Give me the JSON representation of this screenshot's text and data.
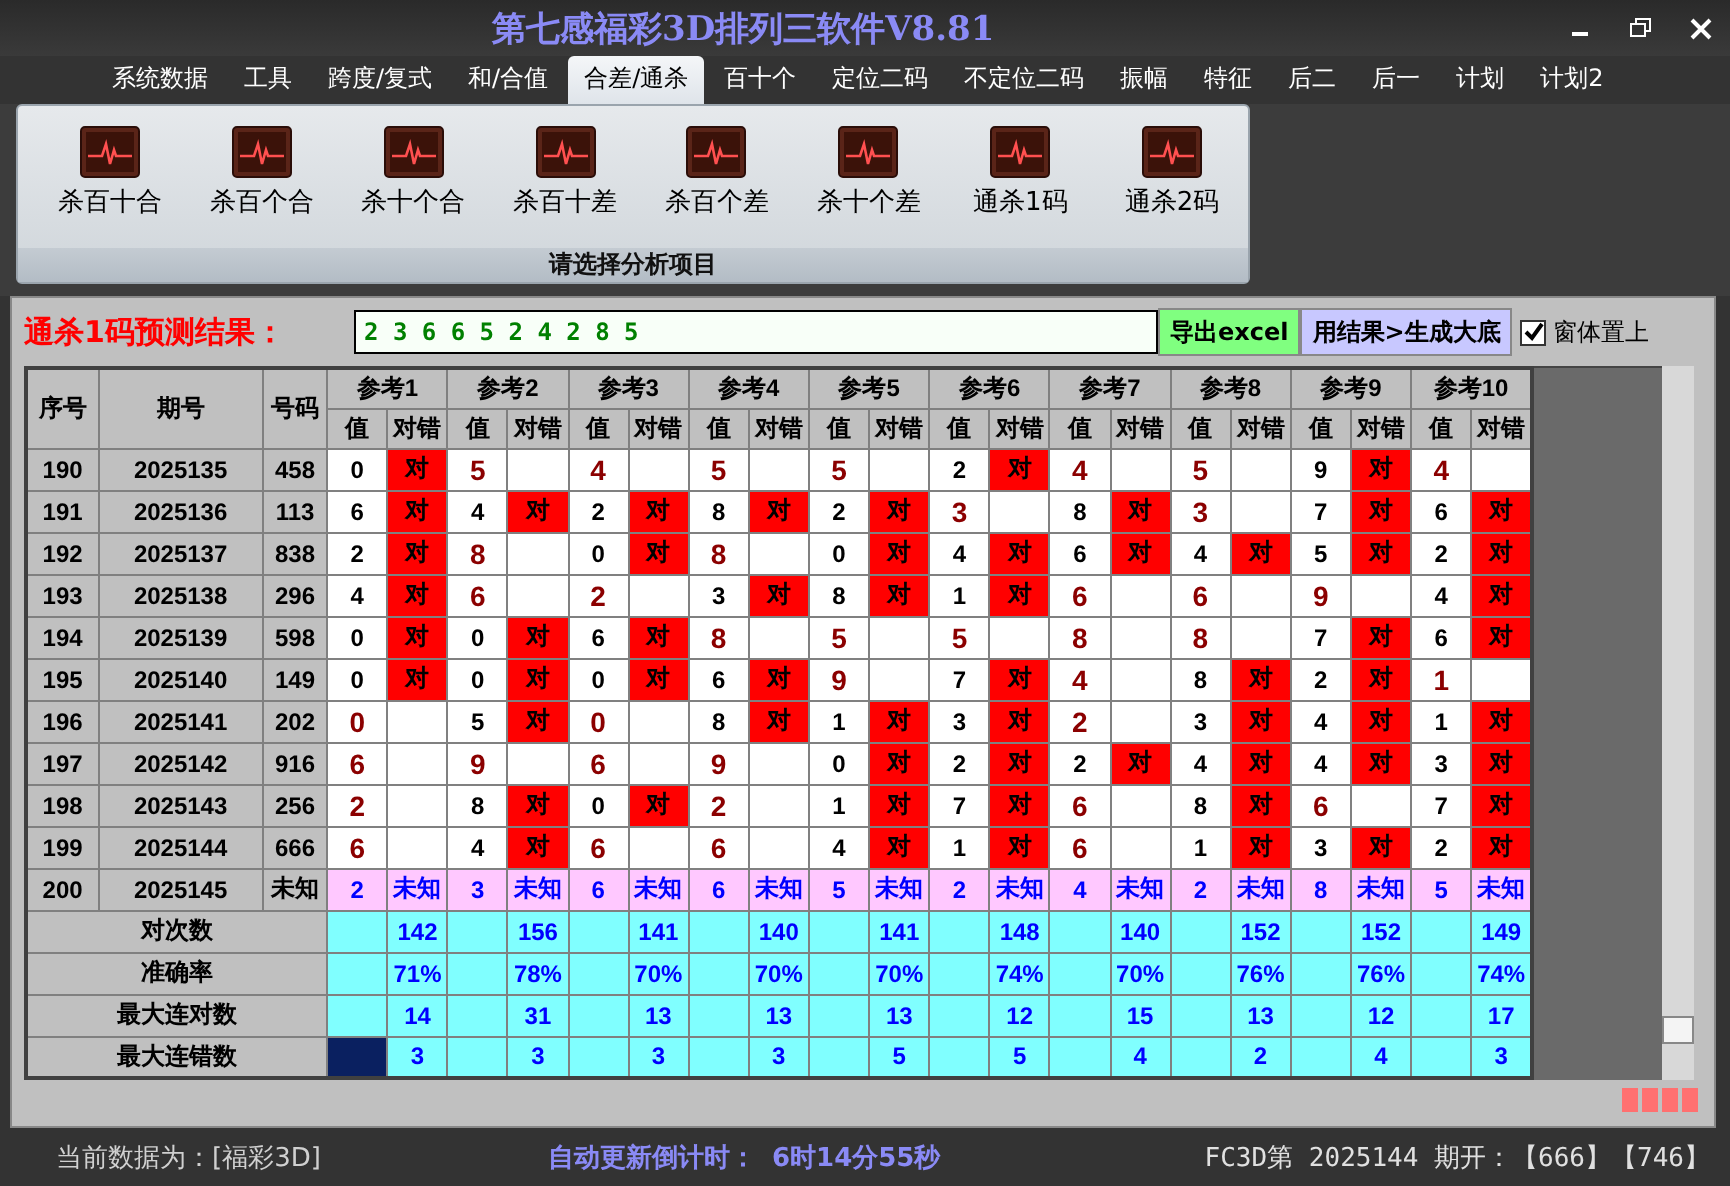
{
  "window": {
    "title": "第七感福彩3D排列三软件V8.81"
  },
  "menu": [
    {
      "label": "系统数据",
      "selected": false
    },
    {
      "label": "工具",
      "selected": false
    },
    {
      "label": "跨度/复式",
      "selected": false
    },
    {
      "label": "和/合值",
      "selected": false
    },
    {
      "label": "合差/通杀",
      "selected": true
    },
    {
      "label": "百十个",
      "selected": false
    },
    {
      "label": "定位二码",
      "selected": false
    },
    {
      "label": "不定位二码",
      "selected": false
    },
    {
      "label": "振幅",
      "selected": false
    },
    {
      "label": "特征",
      "selected": false
    },
    {
      "label": "后二",
      "selected": false
    },
    {
      "label": "后一",
      "selected": false
    },
    {
      "label": "计划",
      "selected": false
    },
    {
      "label": "计划2",
      "selected": false
    }
  ],
  "ribbon": {
    "items": [
      "杀百十合",
      "杀百个合",
      "杀十个合",
      "杀百十差",
      "杀百个差",
      "杀十个差",
      "通杀1码",
      "通杀2码"
    ],
    "group_label": "请选择分析项目"
  },
  "prediction": {
    "label": "通杀1码预测结果：",
    "value": "2 3 6 6 5 2 4 2 8 5",
    "export_button": "导出excel",
    "generate_button": "用结果>生成大底",
    "topmost": {
      "label": "窗体置上",
      "checked": true
    }
  },
  "table": {
    "columns": {
      "index": "序号",
      "period": "期号",
      "number": "号码"
    },
    "refs": [
      {
        "name": "参考1",
        "value_header": "值",
        "hit_header": "对错"
      },
      {
        "name": "参考2",
        "value_header": "值",
        "hit_header": "对错"
      },
      {
        "name": "参考3",
        "value_header": "值",
        "hit_header": "对错"
      },
      {
        "name": "参考4",
        "value_header": "值",
        "hit_header": "对错"
      },
      {
        "name": "参考5",
        "value_header": "值",
        "hit_header": "对错"
      },
      {
        "name": "参考6",
        "value_header": "值",
        "hit_header": "对错"
      },
      {
        "name": "参考7",
        "value_header": "值",
        "hit_header": "对错"
      },
      {
        "name": "参考8",
        "value_header": "值",
        "hit_header": "对错"
      },
      {
        "name": "参考9",
        "value_header": "值",
        "hit_header": "对错"
      },
      {
        "name": "参考10",
        "value_header": "值",
        "hit_header": "对错"
      }
    ],
    "rows": [
      {
        "index": "190",
        "period": "2025135",
        "number": "458",
        "cells": [
          {
            "value": "0",
            "hit": true,
            "result": "对"
          },
          {
            "value": "5",
            "hit": false
          },
          {
            "value": "4",
            "hit": false
          },
          {
            "value": "5",
            "hit": false
          },
          {
            "value": "5",
            "hit": false
          },
          {
            "value": "2",
            "hit": true,
            "result": "对"
          },
          {
            "value": "4",
            "hit": false
          },
          {
            "value": "5",
            "hit": false
          },
          {
            "value": "9",
            "hit": true,
            "result": "对"
          },
          {
            "value": "4",
            "hit": false
          }
        ]
      },
      {
        "index": "191",
        "period": "2025136",
        "number": "113",
        "cells": [
          {
            "value": "6",
            "hit": true,
            "result": "对"
          },
          {
            "value": "4",
            "hit": true,
            "result": "对"
          },
          {
            "value": "2",
            "hit": true,
            "result": "对"
          },
          {
            "value": "8",
            "hit": true,
            "result": "对"
          },
          {
            "value": "2",
            "hit": true,
            "result": "对"
          },
          {
            "value": "3",
            "hit": false
          },
          {
            "value": "8",
            "hit": true,
            "result": "对"
          },
          {
            "value": "3",
            "hit": false
          },
          {
            "value": "7",
            "hit": true,
            "result": "对"
          },
          {
            "value": "6",
            "hit": true,
            "result": "对"
          }
        ]
      },
      {
        "index": "192",
        "period": "2025137",
        "number": "838",
        "cells": [
          {
            "value": "2",
            "hit": true,
            "result": "对"
          },
          {
            "value": "8",
            "hit": false
          },
          {
            "value": "0",
            "hit": true,
            "result": "对"
          },
          {
            "value": "8",
            "hit": false
          },
          {
            "value": "0",
            "hit": true,
            "result": "对"
          },
          {
            "value": "4",
            "hit": true,
            "result": "对"
          },
          {
            "value": "6",
            "hit": true,
            "result": "对"
          },
          {
            "value": "4",
            "hit": true,
            "result": "对"
          },
          {
            "value": "5",
            "hit": true,
            "result": "对"
          },
          {
            "value": "2",
            "hit": true,
            "result": "对"
          }
        ]
      },
      {
        "index": "193",
        "period": "2025138",
        "number": "296",
        "cells": [
          {
            "value": "4",
            "hit": true,
            "result": "对"
          },
          {
            "value": "6",
            "hit": false
          },
          {
            "value": "2",
            "hit": false
          },
          {
            "value": "3",
            "hit": true,
            "result": "对"
          },
          {
            "value": "8",
            "hit": true,
            "result": "对"
          },
          {
            "value": "1",
            "hit": true,
            "result": "对"
          },
          {
            "value": "6",
            "hit": false
          },
          {
            "value": "6",
            "hit": false
          },
          {
            "value": "9",
            "hit": false
          },
          {
            "value": "4",
            "hit": true,
            "result": "对"
          }
        ]
      },
      {
        "index": "194",
        "period": "2025139",
        "number": "598",
        "cells": [
          {
            "value": "0",
            "hit": true,
            "result": "对"
          },
          {
            "value": "0",
            "hit": true,
            "result": "对"
          },
          {
            "value": "6",
            "hit": true,
            "result": "对"
          },
          {
            "value": "8",
            "hit": false
          },
          {
            "value": "5",
            "hit": false
          },
          {
            "value": "5",
            "hit": false
          },
          {
            "value": "8",
            "hit": false
          },
          {
            "value": "8",
            "hit": false
          },
          {
            "value": "7",
            "hit": true,
            "result": "对"
          },
          {
            "value": "6",
            "hit": true,
            "result": "对"
          }
        ]
      },
      {
        "index": "195",
        "period": "2025140",
        "number": "149",
        "cells": [
          {
            "value": "0",
            "hit": true,
            "result": "对"
          },
          {
            "value": "0",
            "hit": true,
            "result": "对"
          },
          {
            "value": "0",
            "hit": true,
            "result": "对"
          },
          {
            "value": "6",
            "hit": true,
            "result": "对"
          },
          {
            "value": "9",
            "hit": false
          },
          {
            "value": "7",
            "hit": true,
            "result": "对"
          },
          {
            "value": "4",
            "hit": false
          },
          {
            "value": "8",
            "hit": true,
            "result": "对"
          },
          {
            "value": "2",
            "hit": true,
            "result": "对"
          },
          {
            "value": "1",
            "hit": false
          }
        ]
      },
      {
        "index": "196",
        "period": "2025141",
        "number": "202",
        "cells": [
          {
            "value": "0",
            "hit": false
          },
          {
            "value": "5",
            "hit": true,
            "result": "对"
          },
          {
            "value": "0",
            "hit": false
          },
          {
            "value": "8",
            "hit": true,
            "result": "对"
          },
          {
            "value": "1",
            "hit": true,
            "result": "对"
          },
          {
            "value": "3",
            "hit": true,
            "result": "对"
          },
          {
            "value": "2",
            "hit": false
          },
          {
            "value": "3",
            "hit": true,
            "result": "对"
          },
          {
            "value": "4",
            "hit": true,
            "result": "对"
          },
          {
            "value": "1",
            "hit": true,
            "result": "对"
          }
        ]
      },
      {
        "index": "197",
        "period": "2025142",
        "number": "916",
        "cells": [
          {
            "value": "6",
            "hit": false
          },
          {
            "value": "9",
            "hit": false
          },
          {
            "value": "6",
            "hit": false
          },
          {
            "value": "9",
            "hit": false
          },
          {
            "value": "0",
            "hit": true,
            "result": "对"
          },
          {
            "value": "2",
            "hit": true,
            "result": "对"
          },
          {
            "value": "2",
            "hit": true,
            "result": "对"
          },
          {
            "value": "4",
            "hit": true,
            "result": "对"
          },
          {
            "value": "4",
            "hit": true,
            "result": "对"
          },
          {
            "value": "3",
            "hit": true,
            "result": "对"
          }
        ]
      },
      {
        "index": "198",
        "period": "2025143",
        "number": "256",
        "cells": [
          {
            "value": "2",
            "hit": false
          },
          {
            "value": "8",
            "hit": true,
            "result": "对"
          },
          {
            "value": "0",
            "hit": true,
            "result": "对"
          },
          {
            "value": "2",
            "hit": false
          },
          {
            "value": "1",
            "hit": true,
            "result": "对"
          },
          {
            "value": "7",
            "hit": true,
            "result": "对"
          },
          {
            "value": "6",
            "hit": false
          },
          {
            "value": "8",
            "hit": true,
            "result": "对"
          },
          {
            "value": "6",
            "hit": false
          },
          {
            "value": "7",
            "hit": true,
            "result": "对"
          }
        ]
      },
      {
        "index": "199",
        "period": "2025144",
        "number": "666",
        "cells": [
          {
            "value": "6",
            "hit": false
          },
          {
            "value": "4",
            "hit": true,
            "result": "对"
          },
          {
            "value": "6",
            "hit": false
          },
          {
            "value": "6",
            "hit": false
          },
          {
            "value": "4",
            "hit": true,
            "result": "对"
          },
          {
            "value": "1",
            "hit": true,
            "result": "对"
          },
          {
            "value": "6",
            "hit": false
          },
          {
            "value": "1",
            "hit": true,
            "result": "对"
          },
          {
            "value": "3",
            "hit": true,
            "result": "对"
          },
          {
            "value": "2",
            "hit": true,
            "result": "对"
          }
        ]
      }
    ],
    "forecast_row": {
      "index": "200",
      "period": "2025145",
      "number": "未知",
      "cells": [
        {
          "value": "2",
          "status": "未知"
        },
        {
          "value": "3",
          "status": "未知"
        },
        {
          "value": "6",
          "status": "未知"
        },
        {
          "value": "6",
          "status": "未知"
        },
        {
          "value": "5",
          "status": "未知"
        },
        {
          "value": "2",
          "status": "未知"
        },
        {
          "value": "4",
          "status": "未知"
        },
        {
          "value": "2",
          "status": "未知"
        },
        {
          "value": "8",
          "status": "未知"
        },
        {
          "value": "5",
          "status": "未知"
        }
      ]
    },
    "stats": [
      {
        "label": "对次数",
        "focused": false,
        "values": [
          "142",
          "156",
          "141",
          "140",
          "141",
          "148",
          "140",
          "152",
          "152",
          "149"
        ]
      },
      {
        "label": "准确率",
        "focused": false,
        "values": [
          "71%",
          "78%",
          "70%",
          "70%",
          "70%",
          "74%",
          "70%",
          "76%",
          "76%",
          "74%"
        ]
      },
      {
        "label": "最大连对数",
        "focused": false,
        "values": [
          "14",
          "31",
          "13",
          "13",
          "13",
          "12",
          "15",
          "13",
          "12",
          "17"
        ]
      },
      {
        "label": "最大连错数",
        "focused": true,
        "values": [
          "3",
          "3",
          "3",
          "3",
          "5",
          "5",
          "4",
          "2",
          "4",
          "3"
        ]
      }
    ]
  },
  "status_bar": {
    "data_source": "当前数据为：[福彩3D]",
    "countdown_label": "自动更新倒计时：",
    "countdown": "6时14分55秒",
    "latest": "FC3D第 2025144 期开：【666】【746】"
  }
}
